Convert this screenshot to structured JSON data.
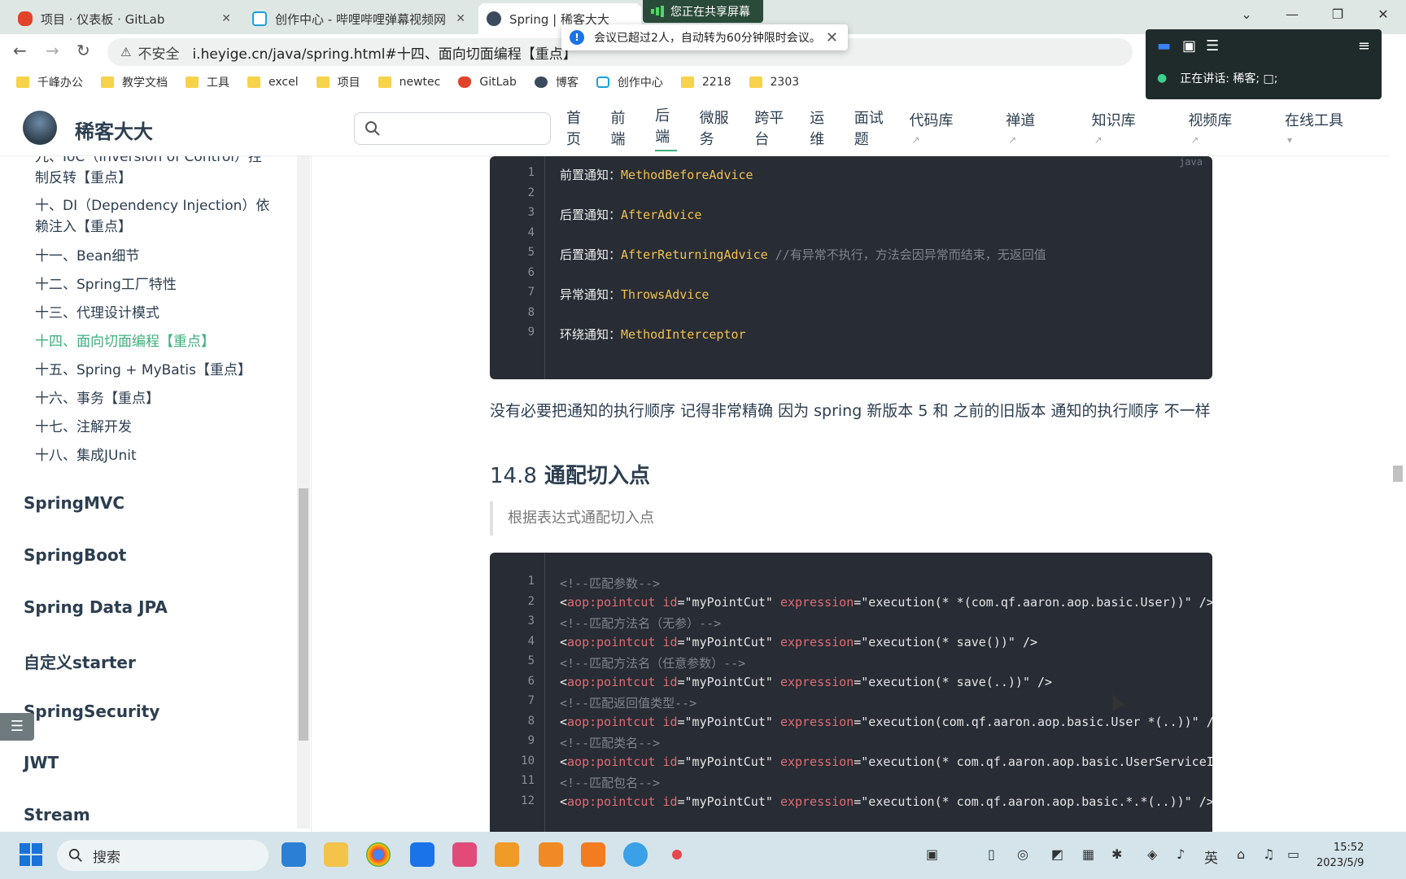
{
  "tabs": [
    {
      "title": "项目 · 仪表板 · GitLab",
      "color": "#e2432a"
    },
    {
      "title": "创作中心 - 哔哩哔哩弹幕视频网",
      "color": "#1ba0d7"
    },
    {
      "title": "Spring | 稀客大大",
      "color": "#3b4a5c"
    }
  ],
  "share_banner": "您正在共享屏幕",
  "url": {
    "insecure": "不安全",
    "address": "i.heyige.cn/java/spring.html#十四、面向切面编程【重点】"
  },
  "meeting_popup": "会议已超过2人，自动转为60分钟限时会议。",
  "meeting_panel": {
    "speaking": "正在讲话:  稀客; □;"
  },
  "bookmarks": [
    "千峰办公",
    "教学文档",
    "工具",
    "excel",
    "项目",
    "newtec",
    "GitLab",
    "博客",
    "创作中心",
    "2218",
    "2303"
  ],
  "site": {
    "name": "稀客大大",
    "search_placeholder": ""
  },
  "nav": [
    {
      "label": "首页"
    },
    {
      "label": "前端"
    },
    {
      "label": "后端"
    },
    {
      "label": "微服务"
    },
    {
      "label": "跨平台"
    },
    {
      "label": "运维"
    },
    {
      "label": "面试题"
    },
    {
      "label": "代码库"
    },
    {
      "label": "禅道"
    },
    {
      "label": "知识库"
    },
    {
      "label": "视频库"
    },
    {
      "label": "在线工具"
    }
  ],
  "sidebar": {
    "subs": [
      "九、IoC（Inversion of Control）控制反转【重点】",
      "十、DI（Dependency Injection）依赖注入【重点】",
      "十一、Bean细节",
      "十二、Spring工厂特性",
      "十三、代理设计模式",
      "十四、面向切面编程【重点】",
      "十五、Spring + MyBatis【重点】",
      "十六、事务【重点】",
      "十七、注解开发",
      "十八、集成JUnit"
    ],
    "groups": [
      "SpringMVC",
      "SpringBoot",
      "Spring Data JPA",
      "自定义starter",
      "SpringSecurity",
      "JWT",
      "Stream"
    ]
  },
  "code1": {
    "lang": "java",
    "lines": [
      {
        "n": "1",
        "a": "前置通知：",
        "b": "MethodBeforeAdvice",
        "c": ""
      },
      {
        "n": "2",
        "a": "",
        "b": "",
        "c": ""
      },
      {
        "n": "3",
        "a": "后置通知：",
        "b": "AfterAdvice",
        "c": ""
      },
      {
        "n": "4",
        "a": "",
        "b": "",
        "c": ""
      },
      {
        "n": "5",
        "a": "后置通知：",
        "b": "AfterReturningAdvice",
        "c": " //有异常不执行，方法会因异常而结束，无返回值"
      },
      {
        "n": "6",
        "a": "",
        "b": "",
        "c": ""
      },
      {
        "n": "7",
        "a": "异常通知：",
        "b": "ThrowsAdvice",
        "c": ""
      },
      {
        "n": "8",
        "a": "",
        "b": "",
        "c": ""
      },
      {
        "n": "9",
        "a": "环绕通知：",
        "b": "MethodInterceptor",
        "c": ""
      }
    ]
  },
  "paragraph": "没有必要把通知的执行顺序 记得非常精确 因为 spring 新版本 5 和 之前的旧版本 通知的执行顺序 不一样",
  "heading": {
    "num": "14.8",
    "text": "通配切入点"
  },
  "quote": "根据表达式通配切入点",
  "code2": {
    "lines": [
      {
        "n": "1",
        "type": "comment",
        "text": "<!--匹配参数-->"
      },
      {
        "n": "2",
        "type": "pc",
        "expr": "\"execution(* *(com.qf.aaron.aop.basic.User))\"",
        "tail": " />"
      },
      {
        "n": "3",
        "type": "comment",
        "text": "<!--匹配方法名（无参）-->"
      },
      {
        "n": "4",
        "type": "pc",
        "expr": "\"execution(* save())\"",
        "tail": " />"
      },
      {
        "n": "5",
        "type": "comment",
        "text": "<!--匹配方法名（任意参数）-->"
      },
      {
        "n": "6",
        "type": "pc",
        "expr": "\"execution(* save(..))\"",
        "tail": " />"
      },
      {
        "n": "7",
        "type": "comment",
        "text": "<!--匹配返回值类型-->"
      },
      {
        "n": "8",
        "type": "pc",
        "expr": "\"execution(com.qf.aaron.aop.basic.User *(..))\"",
        "tail": " />"
      },
      {
        "n": "9",
        "type": "comment",
        "text": "<!--匹配类名-->"
      },
      {
        "n": "10",
        "type": "pc",
        "expr": "\"execution(* com.qf.aaron.aop.basic.UserServiceImpl.*(..))\"",
        "tail": " />"
      },
      {
        "n": "11",
        "type": "comment",
        "text": "<!--匹配包名-->"
      },
      {
        "n": "12",
        "type": "pc",
        "expr": "\"execution(* com.qf.aaron.aop.basic.*.*(..))\"",
        "tail": " />"
      }
    ],
    "tag": "<aop:pointcut",
    "id_attr": "id=",
    "id_val": "\"myPointCut\"",
    "expr_attr": "expression="
  },
  "taskbar": {
    "search": "搜索",
    "time": "15:52",
    "date": "2023/5/9",
    "ime": "英"
  }
}
